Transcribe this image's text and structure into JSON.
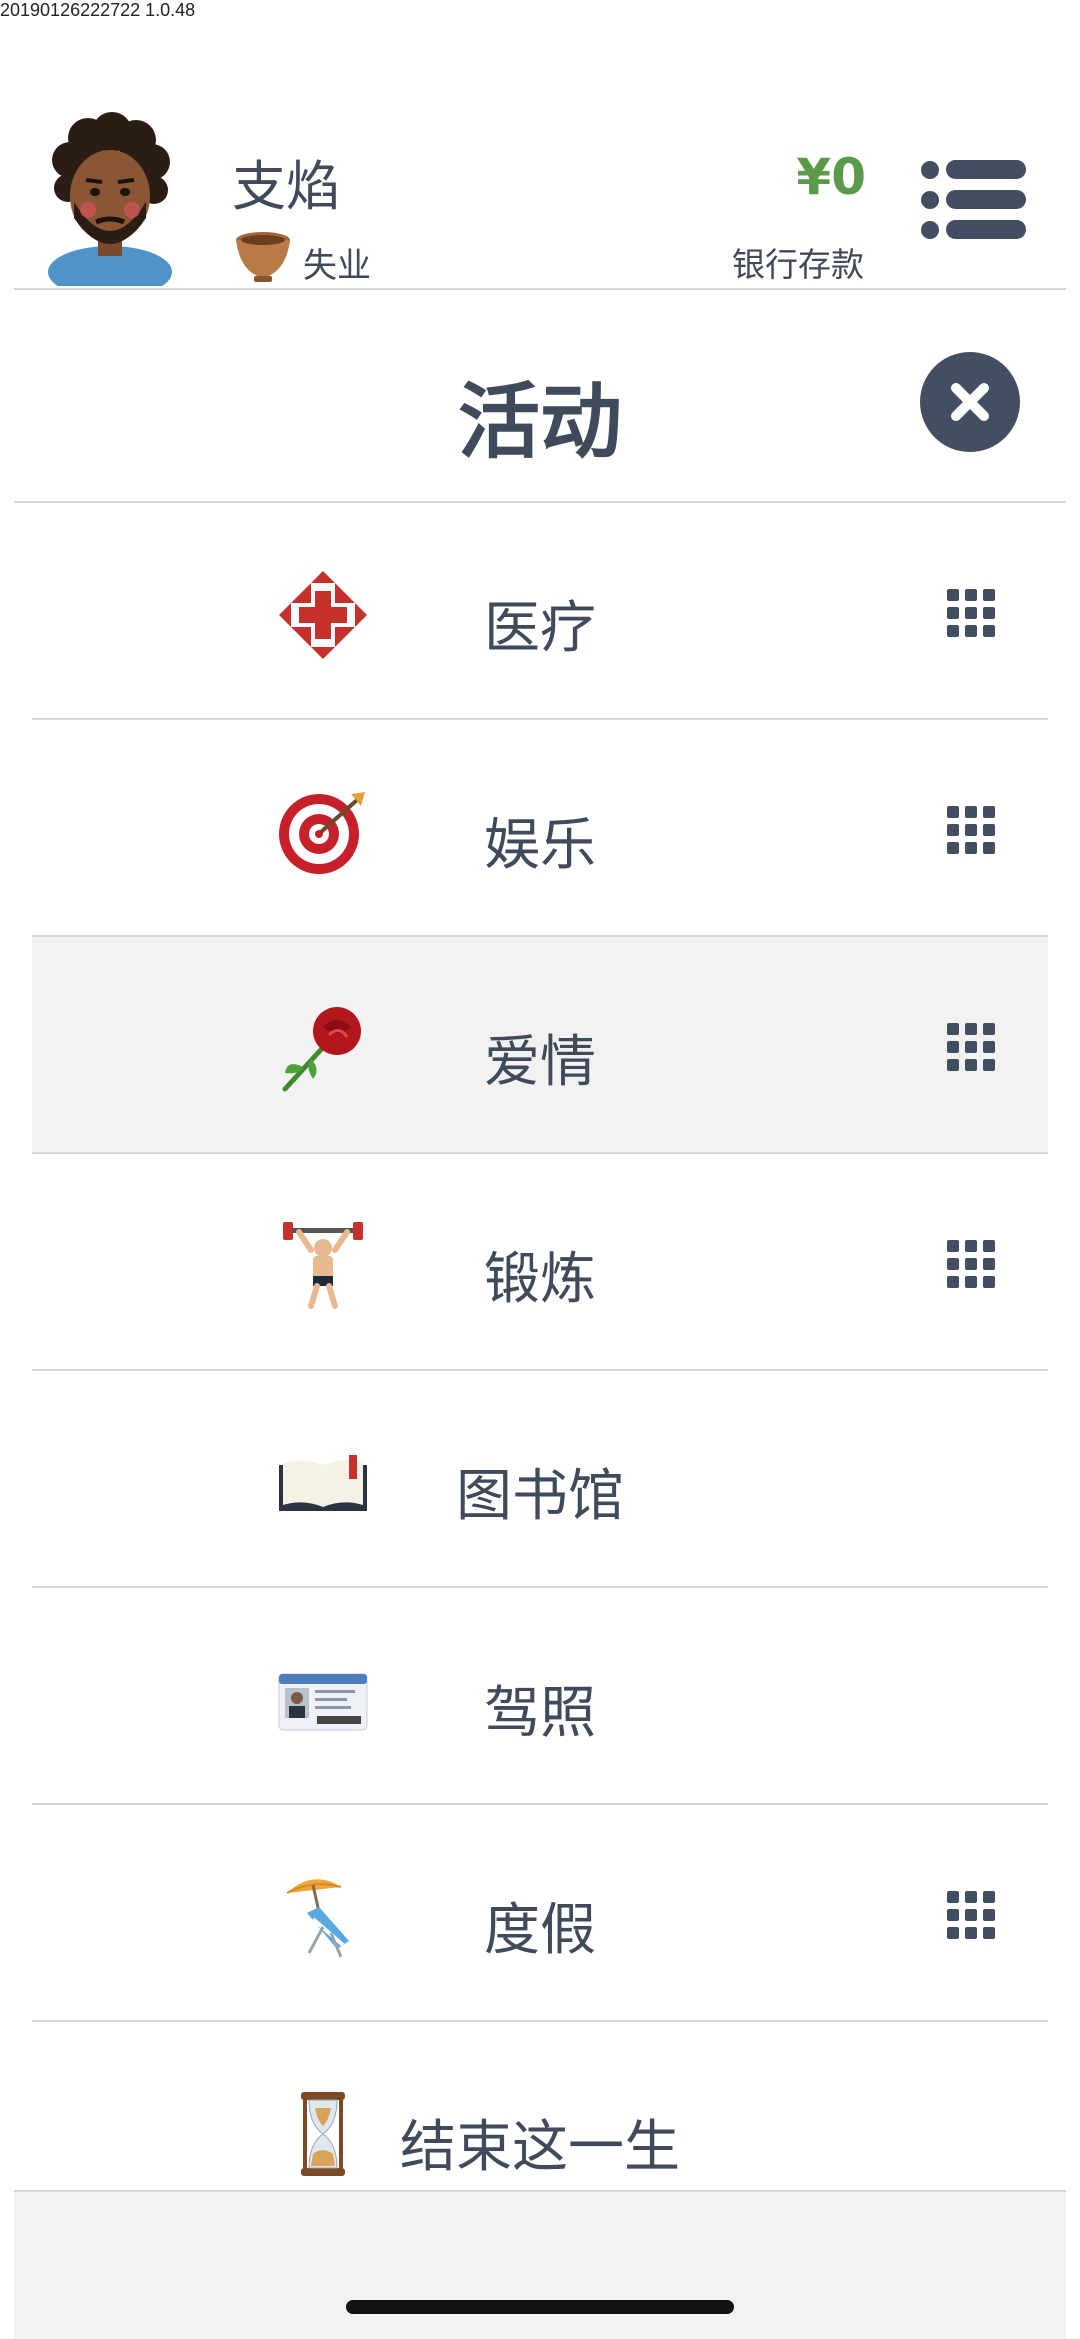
{
  "version_text": "20190126222722 1.0.48",
  "header": {
    "name": "支焰",
    "job": "失业",
    "money": "¥0",
    "money_label": "银行存款"
  },
  "panel": {
    "title": "活动"
  },
  "activities": [
    {
      "label": "医疗",
      "icon": "hospital-cross-icon",
      "has_grid": true
    },
    {
      "label": "娱乐",
      "icon": "dart-target-icon",
      "has_grid": true
    },
    {
      "label": "爱情",
      "icon": "rose-icon",
      "has_grid": true
    },
    {
      "label": "锻炼",
      "icon": "weightlifter-icon",
      "has_grid": true
    },
    {
      "label": "图书馆",
      "icon": "open-book-icon",
      "has_grid": false
    },
    {
      "label": "驾照",
      "icon": "driver-license-icon",
      "has_grid": false
    },
    {
      "label": "度假",
      "icon": "beach-chair-icon",
      "has_grid": true
    },
    {
      "label": "结束这一生",
      "icon": "hourglass-icon",
      "has_grid": false
    }
  ],
  "colors": {
    "text": "#3f4a5a",
    "money": "#5b9a4a",
    "close_bg": "#424f60",
    "active_row": "#f2f2f2"
  }
}
